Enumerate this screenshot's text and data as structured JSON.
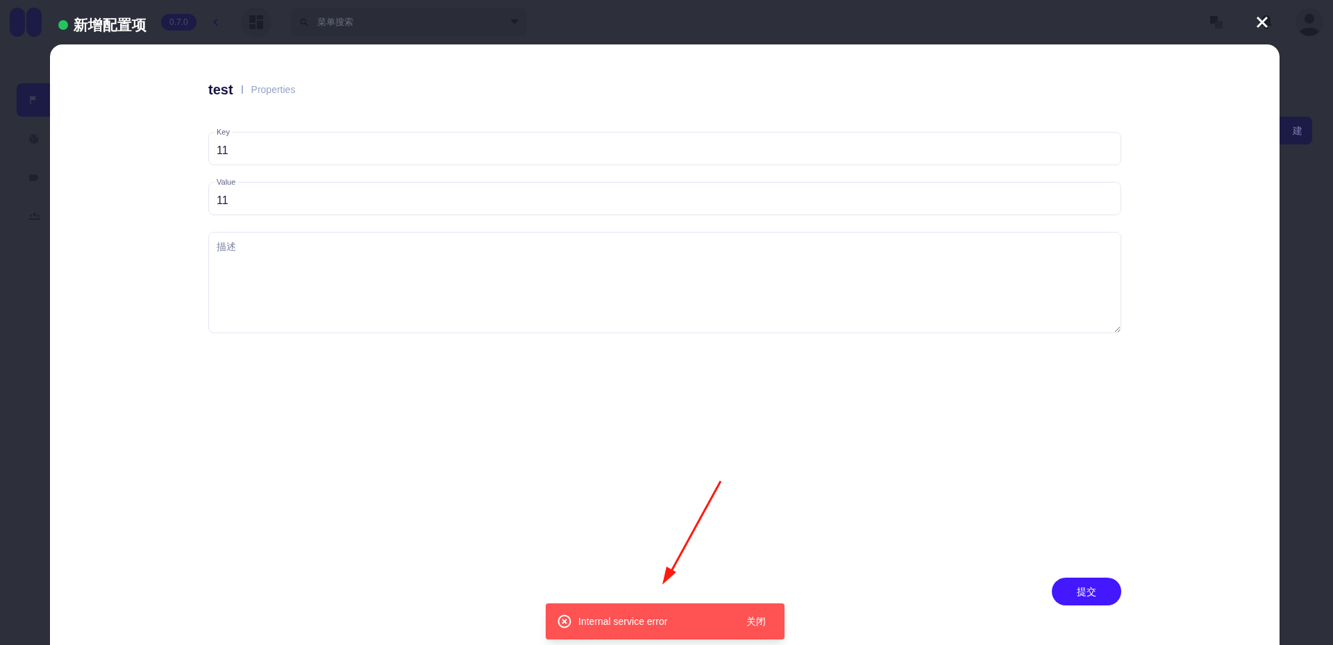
{
  "background_app": {
    "version": "0.7.0",
    "search": {
      "placeholder": "菜单搜索"
    },
    "new_button": "建",
    "sidebar": {
      "items": [
        {
          "selected": true
        },
        {
          "selected": false
        },
        {
          "selected": false
        },
        {
          "selected": false
        }
      ]
    }
  },
  "dialog": {
    "title": "新增配置项",
    "heading": "test",
    "subheading": "Properties",
    "fields": [
      {
        "kind": "input",
        "label": "Key",
        "value": "11"
      },
      {
        "kind": "input",
        "label": "Value",
        "value": "11"
      },
      {
        "kind": "textarea",
        "placeholder": "描述"
      }
    ],
    "submit": "提交"
  },
  "toast": {
    "message": "Internal service error",
    "action": "关闭"
  }
}
